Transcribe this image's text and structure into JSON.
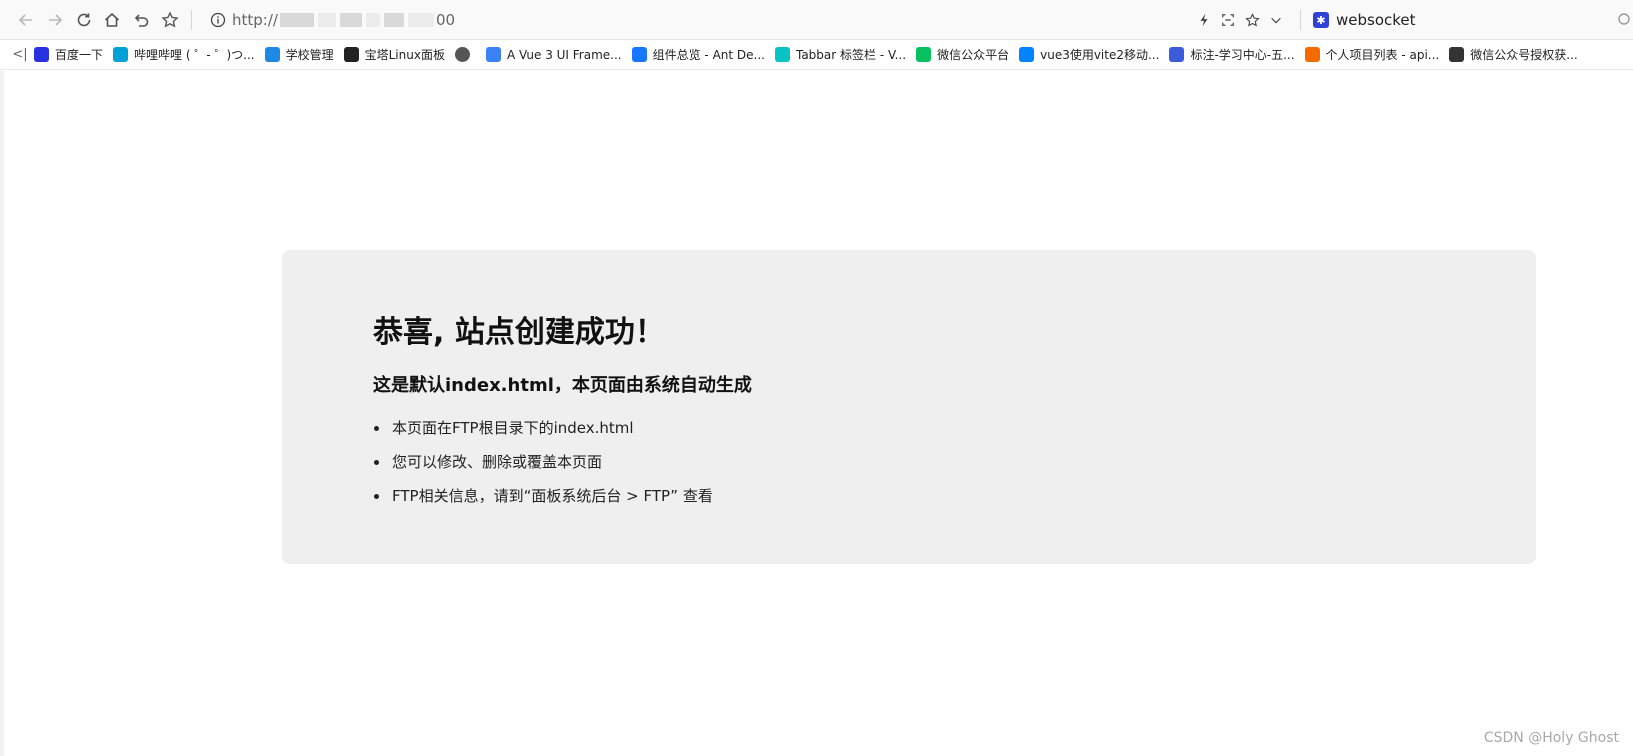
{
  "toolbar": {
    "nav_buttons": [
      "back-icon",
      "forward-icon",
      "reload-icon",
      "home-icon",
      "undo-close-tab-icon",
      "favorite-star-icon"
    ],
    "url_prefix": "http://",
    "url_suffix": "00",
    "search_engine_label": "websocket"
  },
  "bookmarks": [
    {
      "label": "百度一下",
      "icon": "baidu-icon",
      "color": "#2932e1"
    },
    {
      "label": "哔哩哔哩 ( ゜- ゜)つ...",
      "icon": "bilibili-icon",
      "color": "#00a1d6"
    },
    {
      "label": "学校管理",
      "icon": "book-icon",
      "color": "#1e88e5"
    },
    {
      "label": "宝塔Linux面板",
      "icon": "bt-icon",
      "color": "#222222"
    },
    {
      "label": "",
      "icon": "globe-icon",
      "color": "#555555"
    },
    {
      "label": "A Vue 3 UI Frame...",
      "icon": "vue-ui-icon",
      "color": "#3b82f6"
    },
    {
      "label": "组件总览 - Ant De...",
      "icon": "ant-design-icon",
      "color": "#1677ff"
    },
    {
      "label": "Tabbar 标签栏 - V...",
      "icon": "vant-icon",
      "color": "#07c3c3"
    },
    {
      "label": "微信公众平台",
      "icon": "wechat-icon",
      "color": "#07c160"
    },
    {
      "label": "vue3使用vite2移动...",
      "icon": "zhihu-icon",
      "color": "#0084ff"
    },
    {
      "label": "标注-学习中心-五...",
      "icon": "bookmark-icon",
      "color": "#3b5bdb"
    },
    {
      "label": "个人项目列表 - api...",
      "icon": "api-icon",
      "color": "#f56a00"
    },
    {
      "label": "微信公众号授权获...",
      "icon": "csdn-icon",
      "color": "#333333"
    }
  ],
  "panel": {
    "title": "恭喜, 站点创建成功！",
    "subtitle": "这是默认index.html，本页面由系统自动生成",
    "items": [
      "本页面在FTP根目录下的index.html",
      "您可以修改、删除或覆盖本页面",
      "FTP相关信息，请到“面板系统后台 > FTP” 查看"
    ]
  },
  "watermark": "CSDN @Holy Ghost"
}
